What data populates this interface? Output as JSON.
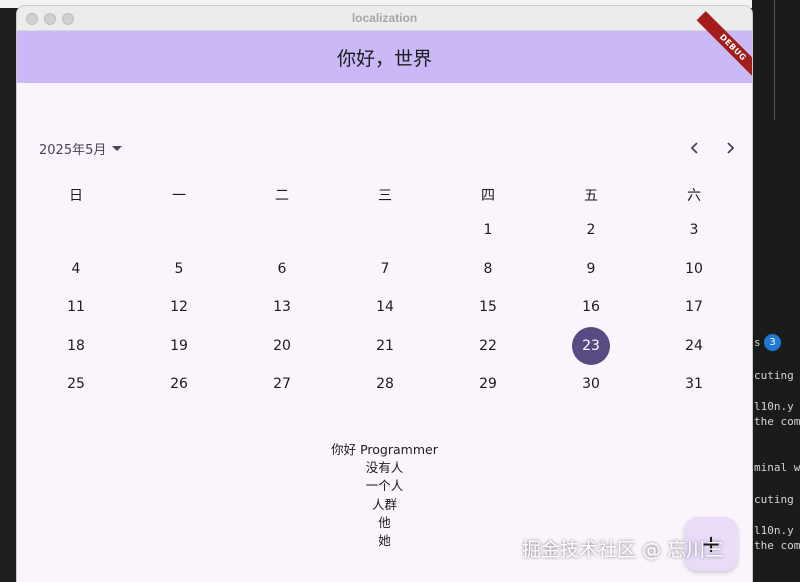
{
  "window": {
    "title": "localization"
  },
  "appbar": {
    "title": "你好，世界"
  },
  "debug_banner": "DEBUG",
  "calendar": {
    "month_label": "2025年5月",
    "weekdays": [
      "日",
      "一",
      "二",
      "三",
      "四",
      "五",
      "六"
    ],
    "days": [
      "1",
      "2",
      "3",
      "4",
      "5",
      "6",
      "7",
      "8",
      "9",
      "10",
      "11",
      "12",
      "13",
      "14",
      "15",
      "16",
      "17",
      "18",
      "19",
      "20",
      "21",
      "22",
      "23",
      "24",
      "25",
      "26",
      "27",
      "28",
      "29",
      "30",
      "31"
    ],
    "first_weekday_index": 4,
    "selected_day": "23",
    "selected_color": "#5a4a84"
  },
  "text_list": [
    "你好 Programmer",
    "没有人",
    "一个人",
    "人群",
    "他",
    "她"
  ],
  "fab": {
    "icon": "add-icon",
    "label": "+"
  },
  "watermark": "掘金技术社区 @ 忘川三",
  "background": {
    "terminal_lines": [
      "s",
      "cuting",
      "l10n.y",
      "the com",
      "minal w",
      "cuting",
      "l10n.y",
      "the com"
    ],
    "badge": "3"
  },
  "colors": {
    "appbar": "#cbb9f7",
    "surface": "#fbf4fc",
    "selected": "#5a4a84",
    "debug": "#a31d1d"
  }
}
